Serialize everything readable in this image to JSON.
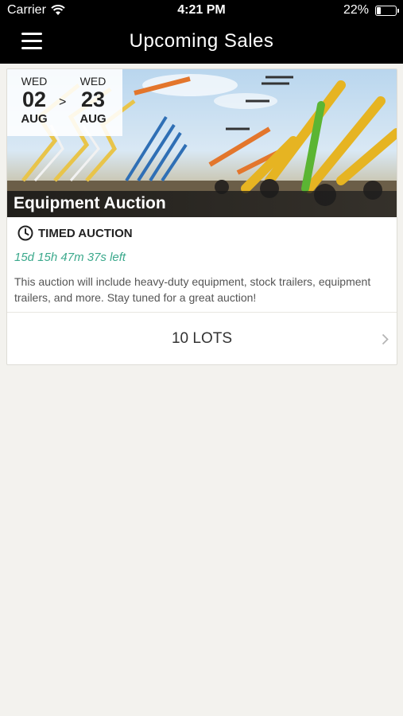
{
  "status_bar": {
    "carrier": "Carrier",
    "time": "4:21 PM",
    "battery": "22%",
    "battery_level": 0.22
  },
  "nav": {
    "title": "Upcoming Sales",
    "menu_icon": "hamburger-menu-icon"
  },
  "sale": {
    "start": {
      "dow": "WED",
      "day": "02",
      "month": "AUG"
    },
    "separator": ">",
    "end": {
      "dow": "WED",
      "day": "23",
      "month": "AUG"
    },
    "title": "Equipment Auction",
    "type_icon": "clock-icon",
    "type": "TIMED AUCTION",
    "countdown": "15d 15h 47m 37s left",
    "description": "This auction will include heavy-duty equipment, stock trailers, equipment trailers, and more. Stay tuned for a great auction!",
    "lots_label": "10 LOTS",
    "lots_icon": "chevron-right-icon"
  },
  "colors": {
    "accent": "#3ba98c",
    "background": "#f3f2ee",
    "nav": "#000000"
  }
}
